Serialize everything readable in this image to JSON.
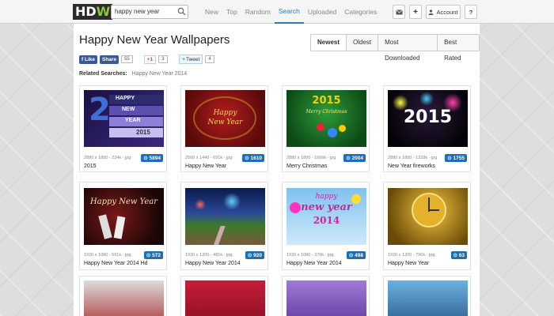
{
  "logo": {
    "text_a": "HD",
    "text_b": "W"
  },
  "search": {
    "value": "happy new year"
  },
  "nav": [
    {
      "label": "New"
    },
    {
      "label": "Top"
    },
    {
      "label": "Random"
    },
    {
      "label": "Search",
      "active": true
    },
    {
      "label": "Uploaded"
    },
    {
      "label": "Categories"
    }
  ],
  "toolbar": {
    "account_label": "Account",
    "help_label": "?",
    "add_label": "+"
  },
  "page": {
    "title": "Happy New Year Wallpapers"
  },
  "sort": [
    "Newest",
    "Oldest",
    "Most Downloaded",
    "Best Rated"
  ],
  "social": {
    "fb_like": "Like",
    "fb_share": "Share",
    "fb_count": "55",
    "gplus_label": "+1",
    "gplus_count": "3",
    "tweet_label": "Tweet",
    "tweet_count": "4"
  },
  "related": {
    "label": "Related Searches:",
    "link": "Happy New Year 2014"
  },
  "wallpapers": [
    {
      "meta": "2880 x 1800 - 234k - jpg",
      "title": "2015",
      "count": "5894",
      "thumb_text": "HAPPY NEW YEAR 2015"
    },
    {
      "meta": "2560 x 1440 - 691k - jpg",
      "title": "Happy New Year",
      "count": "1610",
      "thumb_text": "Happy New Year"
    },
    {
      "meta": "2880 x 1800 - 1666k - jpg",
      "title": "Merry Christmas",
      "count": "2004",
      "thumb_text": "2015"
    },
    {
      "meta": "2880 x 1800 - 1328k - jpg",
      "title": "New Year fireworks",
      "count": "1755",
      "thumb_text": "2015"
    },
    {
      "meta": "1920 x 1080 - 591k - jpg",
      "title": "Happy New Year 2014 Hd",
      "count": "572",
      "thumb_text": "Happy New Year"
    },
    {
      "meta": "1920 x 1200 - 481k - jpg",
      "title": "Happy New Year 2014",
      "count": "920",
      "thumb_text": ""
    },
    {
      "meta": "1920 x 1080 - 370k - jpg",
      "title": "Happy New Year 2014",
      "count": "498",
      "thumb_text": "happy new year 2014"
    },
    {
      "meta": "1920 x 1200 - 796k - jpg",
      "title": "Happy New Year",
      "count": "63",
      "thumb_text": ""
    }
  ],
  "colors": {
    "accent": "#2a7ab8",
    "badge": "#1c6fb5",
    "logo_green": "#8cc63f"
  }
}
